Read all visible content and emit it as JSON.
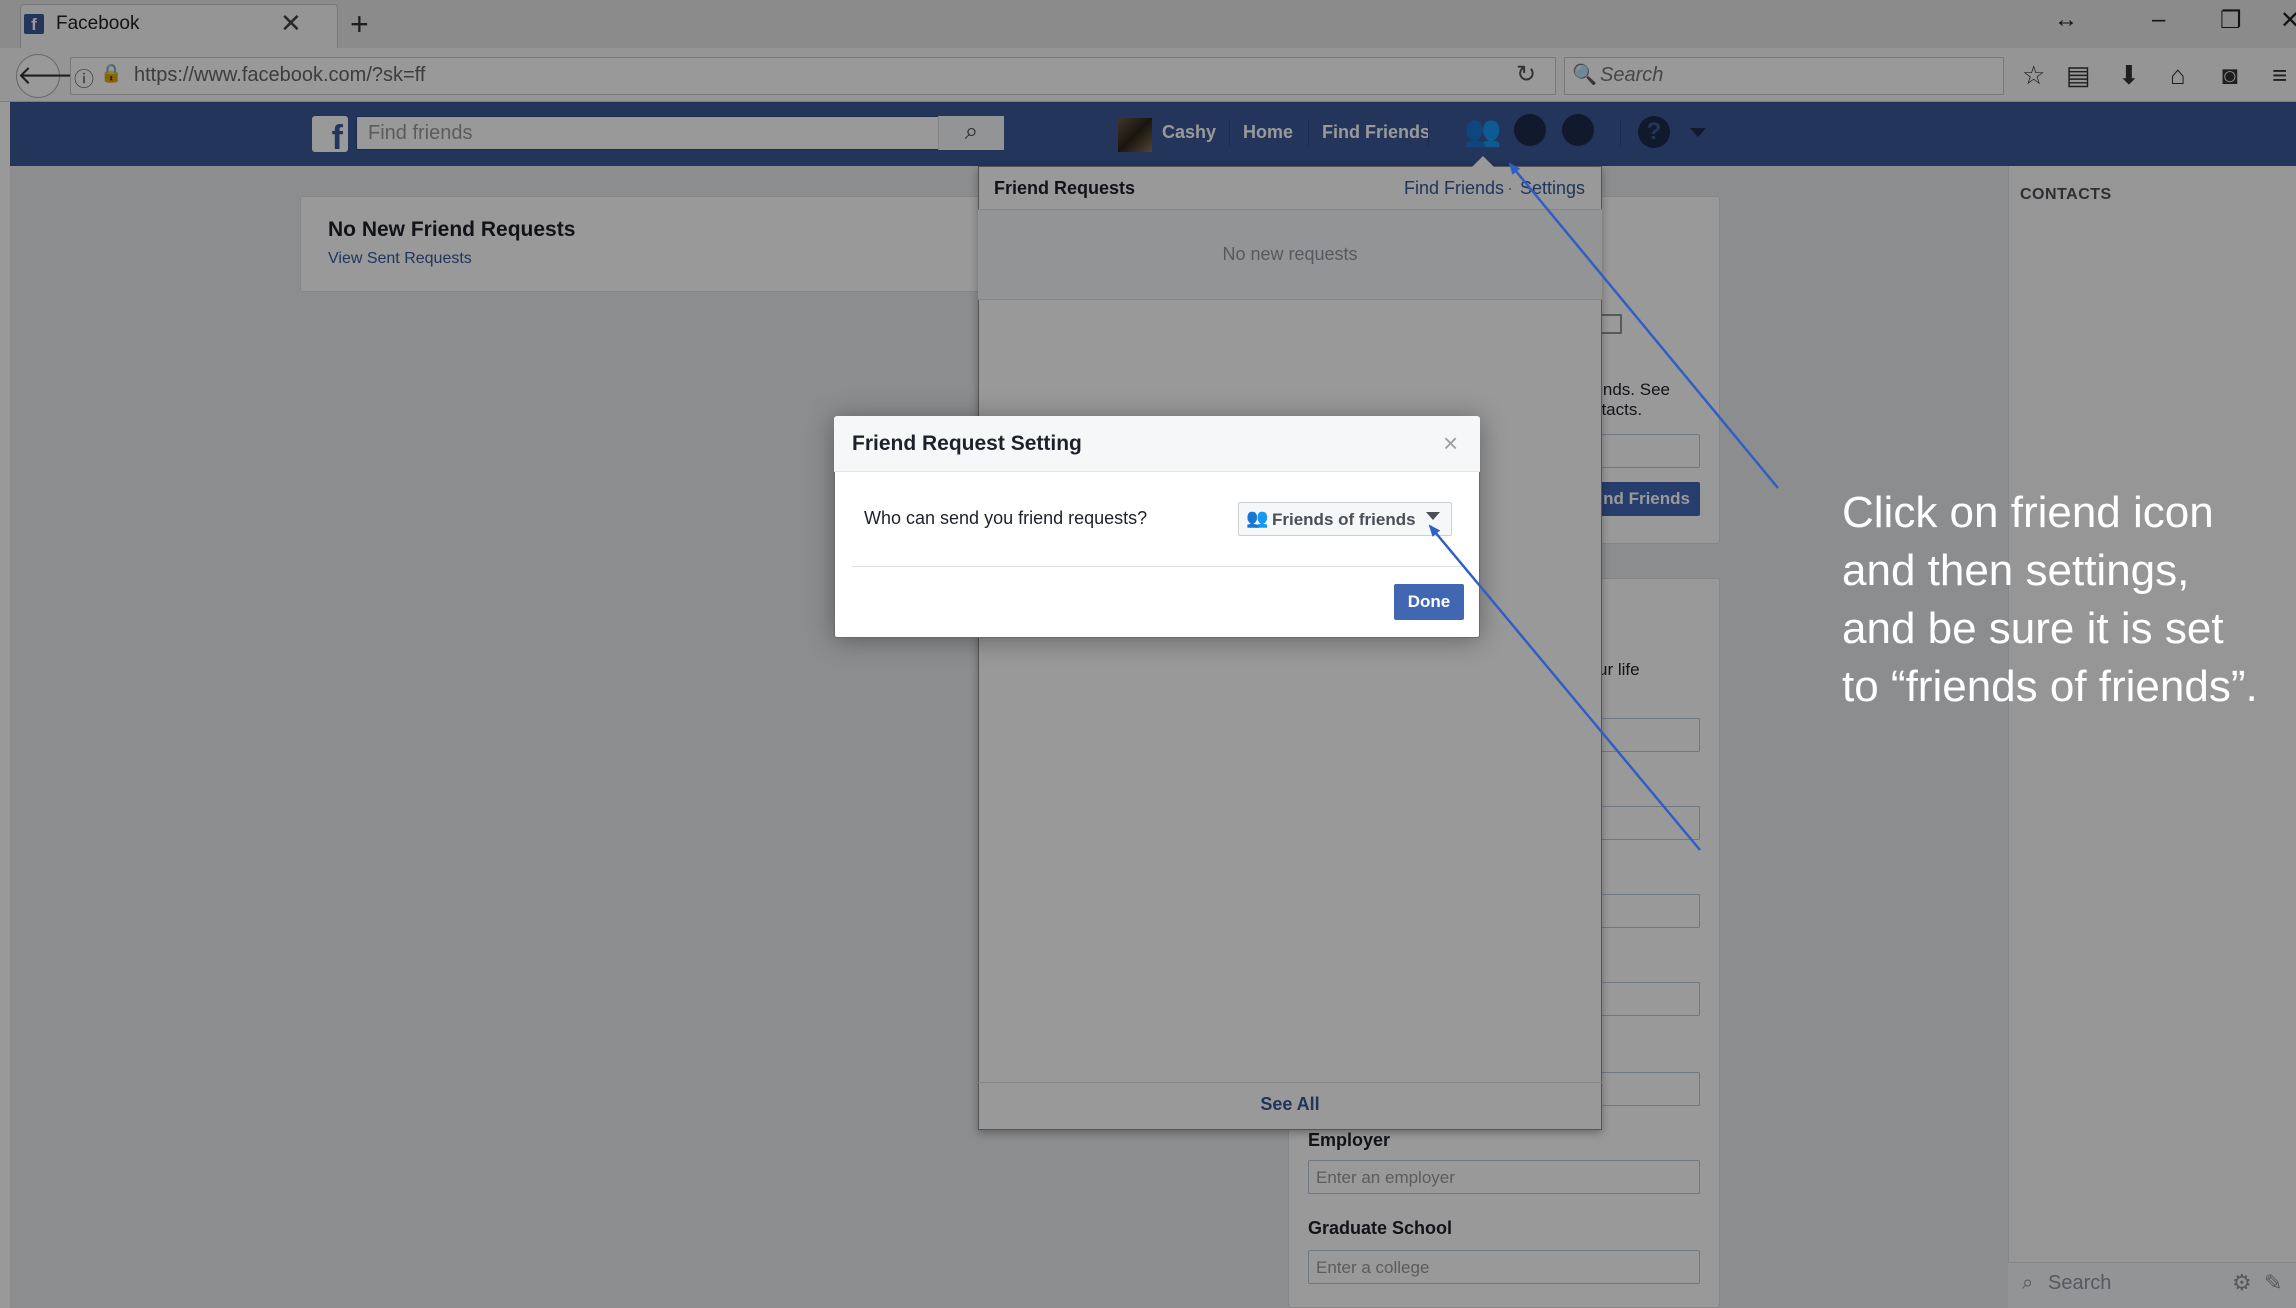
{
  "browser": {
    "tab_title": "Facebook",
    "tab_close": "✕",
    "new_tab": "+",
    "url": "https://www.facebook.com/?sk=ff",
    "search_placeholder": "Search",
    "window_buttons": [
      "↔",
      "–",
      "❐",
      "✕"
    ]
  },
  "fb_header": {
    "logo": "f",
    "search_placeholder": "Find friends",
    "user_name": "Cashy",
    "nav_home": "Home",
    "nav_find_friends": "Find Friends",
    "help": "?"
  },
  "left_card": {
    "title": "No New Friend Requests",
    "link": "View Sent Requests"
  },
  "right_card": {
    "partial_text_1": "riends. See",
    "partial_text_2": "ntacts.",
    "find_button": "nd Friends",
    "partial_text_3": "ur life",
    "employer_label": "Employer",
    "employer_placeholder": "Enter an employer",
    "grad_label": "Graduate School",
    "grad_placeholder": "Enter a college"
  },
  "contacts": {
    "title": "CONTACTS",
    "search_placeholder": "Search"
  },
  "flyout": {
    "title": "Friend Requests",
    "find_friends": "Find Friends",
    "dot": "·",
    "settings": "Settings",
    "empty": "No new requests",
    "see_all": "See All"
  },
  "dialog": {
    "title": "Friend Request Setting",
    "close": "×",
    "question": "Who can send you friend requests?",
    "selected": "Friends of friends",
    "done": "Done"
  },
  "annotation": {
    "text": "Click on  friend icon and then settings,  and be sure it is set to “friends of friends”."
  },
  "colors": {
    "fb_blue": "#3b5998",
    "button_blue": "#4267b2",
    "link_blue": "#365899",
    "annotation_arrow": "#2f5fc4"
  }
}
